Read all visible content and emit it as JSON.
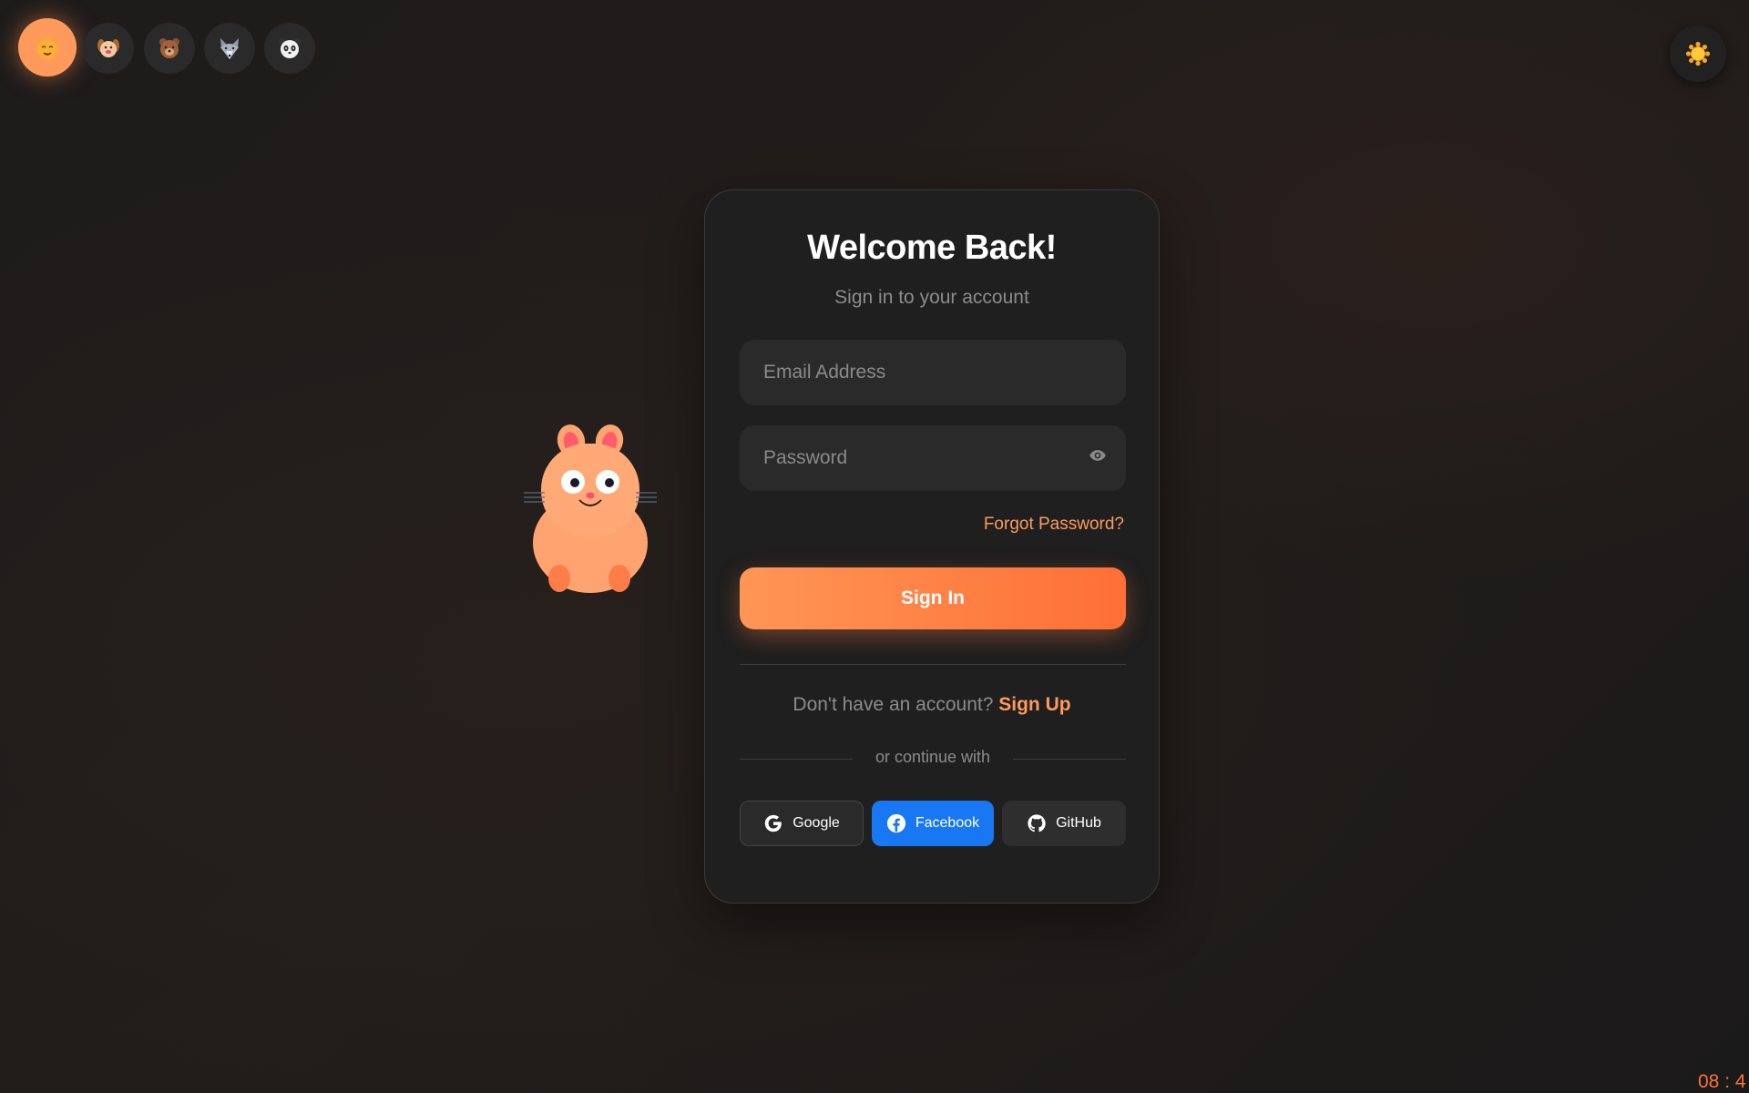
{
  "avatars": [
    {
      "name": "cat",
      "active": true
    },
    {
      "name": "dog",
      "active": false
    },
    {
      "name": "bear",
      "active": false
    },
    {
      "name": "wolf",
      "active": false
    },
    {
      "name": "panda",
      "active": false
    }
  ],
  "theme_toggle": {
    "icon": "sun-icon"
  },
  "card": {
    "title": "Welcome Back!",
    "subtitle": "Sign in to your account",
    "email_placeholder": "Email Address",
    "email_value": "",
    "password_placeholder": "Password",
    "password_value": "",
    "forgot_password": "Forgot Password?",
    "sign_in_label": "Sign In",
    "no_account_text": "Don't have an account?",
    "sign_up_label": "Sign Up",
    "or_continue": "or continue with",
    "social": {
      "google": "Google",
      "facebook": "Facebook",
      "github": "GitHub"
    }
  },
  "clock": "08 : 4",
  "colors": {
    "accent": "#ff9a5c",
    "accent_dark": "#ff6f35",
    "facebook": "#1877f2",
    "card_bg": "#1f1f1f",
    "input_bg": "#2a2a2a"
  }
}
